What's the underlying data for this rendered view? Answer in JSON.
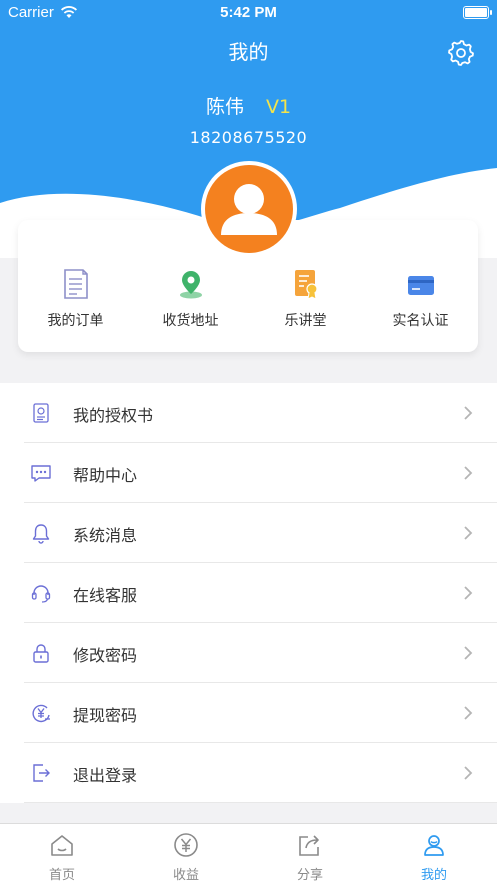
{
  "status_bar": {
    "carrier": "Carrier",
    "time": "5:42 PM"
  },
  "nav": {
    "title": "我的"
  },
  "profile": {
    "name": "陈伟",
    "level": "V1",
    "phone": "18208675520"
  },
  "quick_actions": [
    {
      "label": "我的订单",
      "icon": "order-doc-icon"
    },
    {
      "label": "收货地址",
      "icon": "location-pin-icon"
    },
    {
      "label": "乐讲堂",
      "icon": "certificate-icon"
    },
    {
      "label": "实名认证",
      "icon": "id-card-icon"
    }
  ],
  "menu": [
    {
      "label": "我的授权书",
      "icon": "authorization-doc-icon"
    },
    {
      "label": "帮助中心",
      "icon": "chat-bubble-icon"
    },
    {
      "label": "系统消息",
      "icon": "bell-icon"
    },
    {
      "label": "在线客服",
      "icon": "headset-icon"
    },
    {
      "label": "修改密码",
      "icon": "lock-icon"
    },
    {
      "label": "提现密码",
      "icon": "yuan-coin-icon"
    },
    {
      "label": "退出登录",
      "icon": "logout-icon"
    }
  ],
  "tabs": [
    {
      "label": "首页",
      "icon": "home-icon",
      "active": false
    },
    {
      "label": "收益",
      "icon": "yuan-circle-icon",
      "active": false
    },
    {
      "label": "分享",
      "icon": "share-icon",
      "active": false
    },
    {
      "label": "我的",
      "icon": "user-icon",
      "active": true
    }
  ],
  "colors": {
    "primary": "#2f9bf0",
    "level": "#f3e44b",
    "avatar": "#f4811f",
    "icon_purple": "#6b6fd6"
  }
}
